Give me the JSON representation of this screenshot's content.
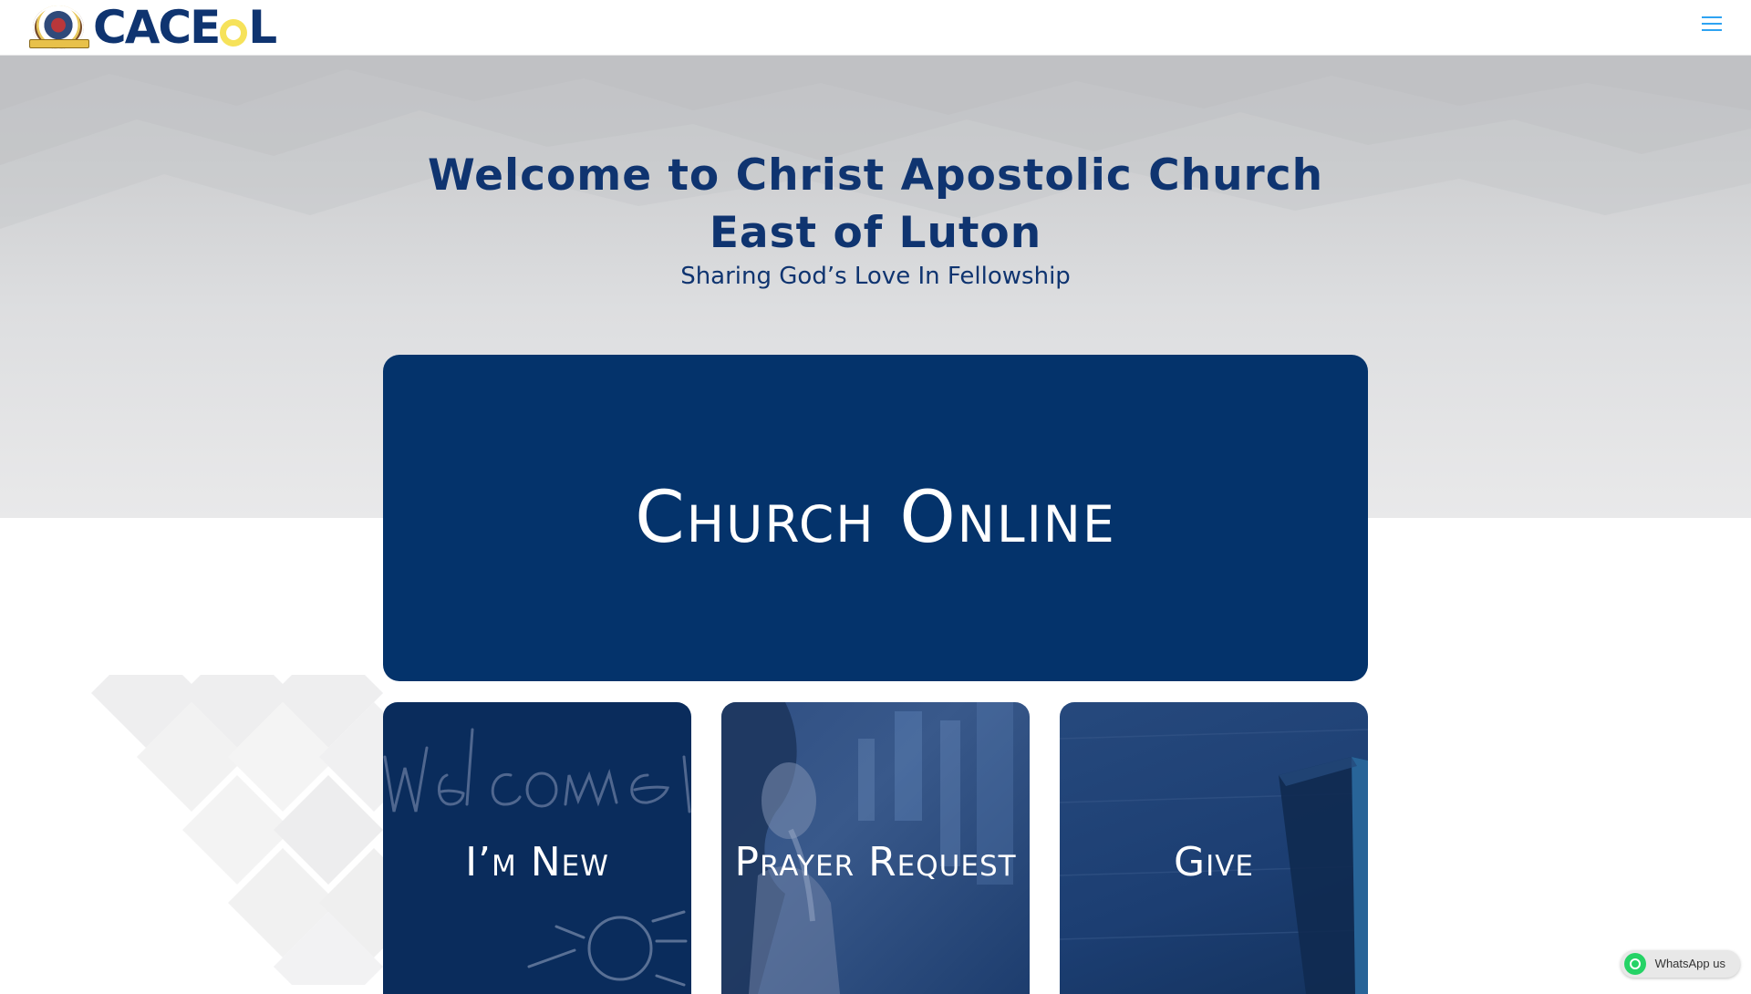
{
  "header": {
    "logo_text_part1": "CACE",
    "logo_text_part2": "L",
    "menu_icon": "hamburger-menu-icon"
  },
  "hero": {
    "title": "Welcome to Christ Apostolic Church East of Luton",
    "subtitle": "Sharing God’s Love In Fellowship"
  },
  "church_online": {
    "label": "Church Online"
  },
  "tiles": [
    {
      "label": "I’m New",
      "image": "chalkboard-welcome"
    },
    {
      "label": "Prayer Request",
      "image": "woman-praying"
    },
    {
      "label": "Give",
      "image": "bible-on-wood"
    }
  ],
  "whatsapp": {
    "label": "WhatsApp us",
    "icon": "whatsapp-icon"
  },
  "colors": {
    "brand_navy": "#04336b",
    "logo_yellow": "#f6e25a",
    "menu_blue": "#2ea3f2",
    "whatsapp_green": "#25d366"
  }
}
